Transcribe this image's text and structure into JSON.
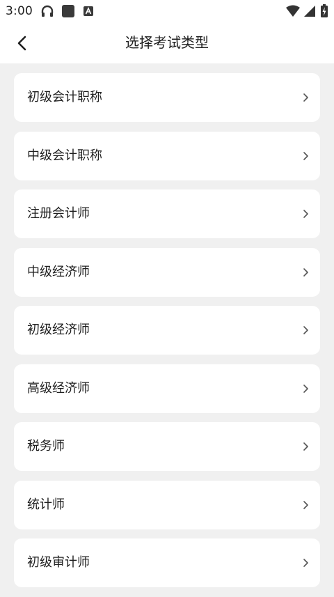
{
  "status_bar": {
    "time": "3:00",
    "left_icons": [
      "headphones-icon",
      "app-square-icon",
      "a-badge-icon"
    ],
    "right_icons": [
      "wifi-icon",
      "cell-signal-icon",
      "battery-charging-icon"
    ]
  },
  "header": {
    "title": "选择考试类型",
    "back_icon": "chevron-left-icon"
  },
  "exam_types": [
    {
      "label": "初级会计职称"
    },
    {
      "label": "中级会计职称"
    },
    {
      "label": "注册会计师"
    },
    {
      "label": "中级经济师"
    },
    {
      "label": "初级经济师"
    },
    {
      "label": "高级经济师"
    },
    {
      "label": "税务师"
    },
    {
      "label": "统计师"
    },
    {
      "label": "初级审计师"
    }
  ],
  "colors": {
    "page_bg": "#f0f0f0",
    "card_bg": "#ffffff",
    "text": "#1f1f1f",
    "chevron": "#555555"
  }
}
